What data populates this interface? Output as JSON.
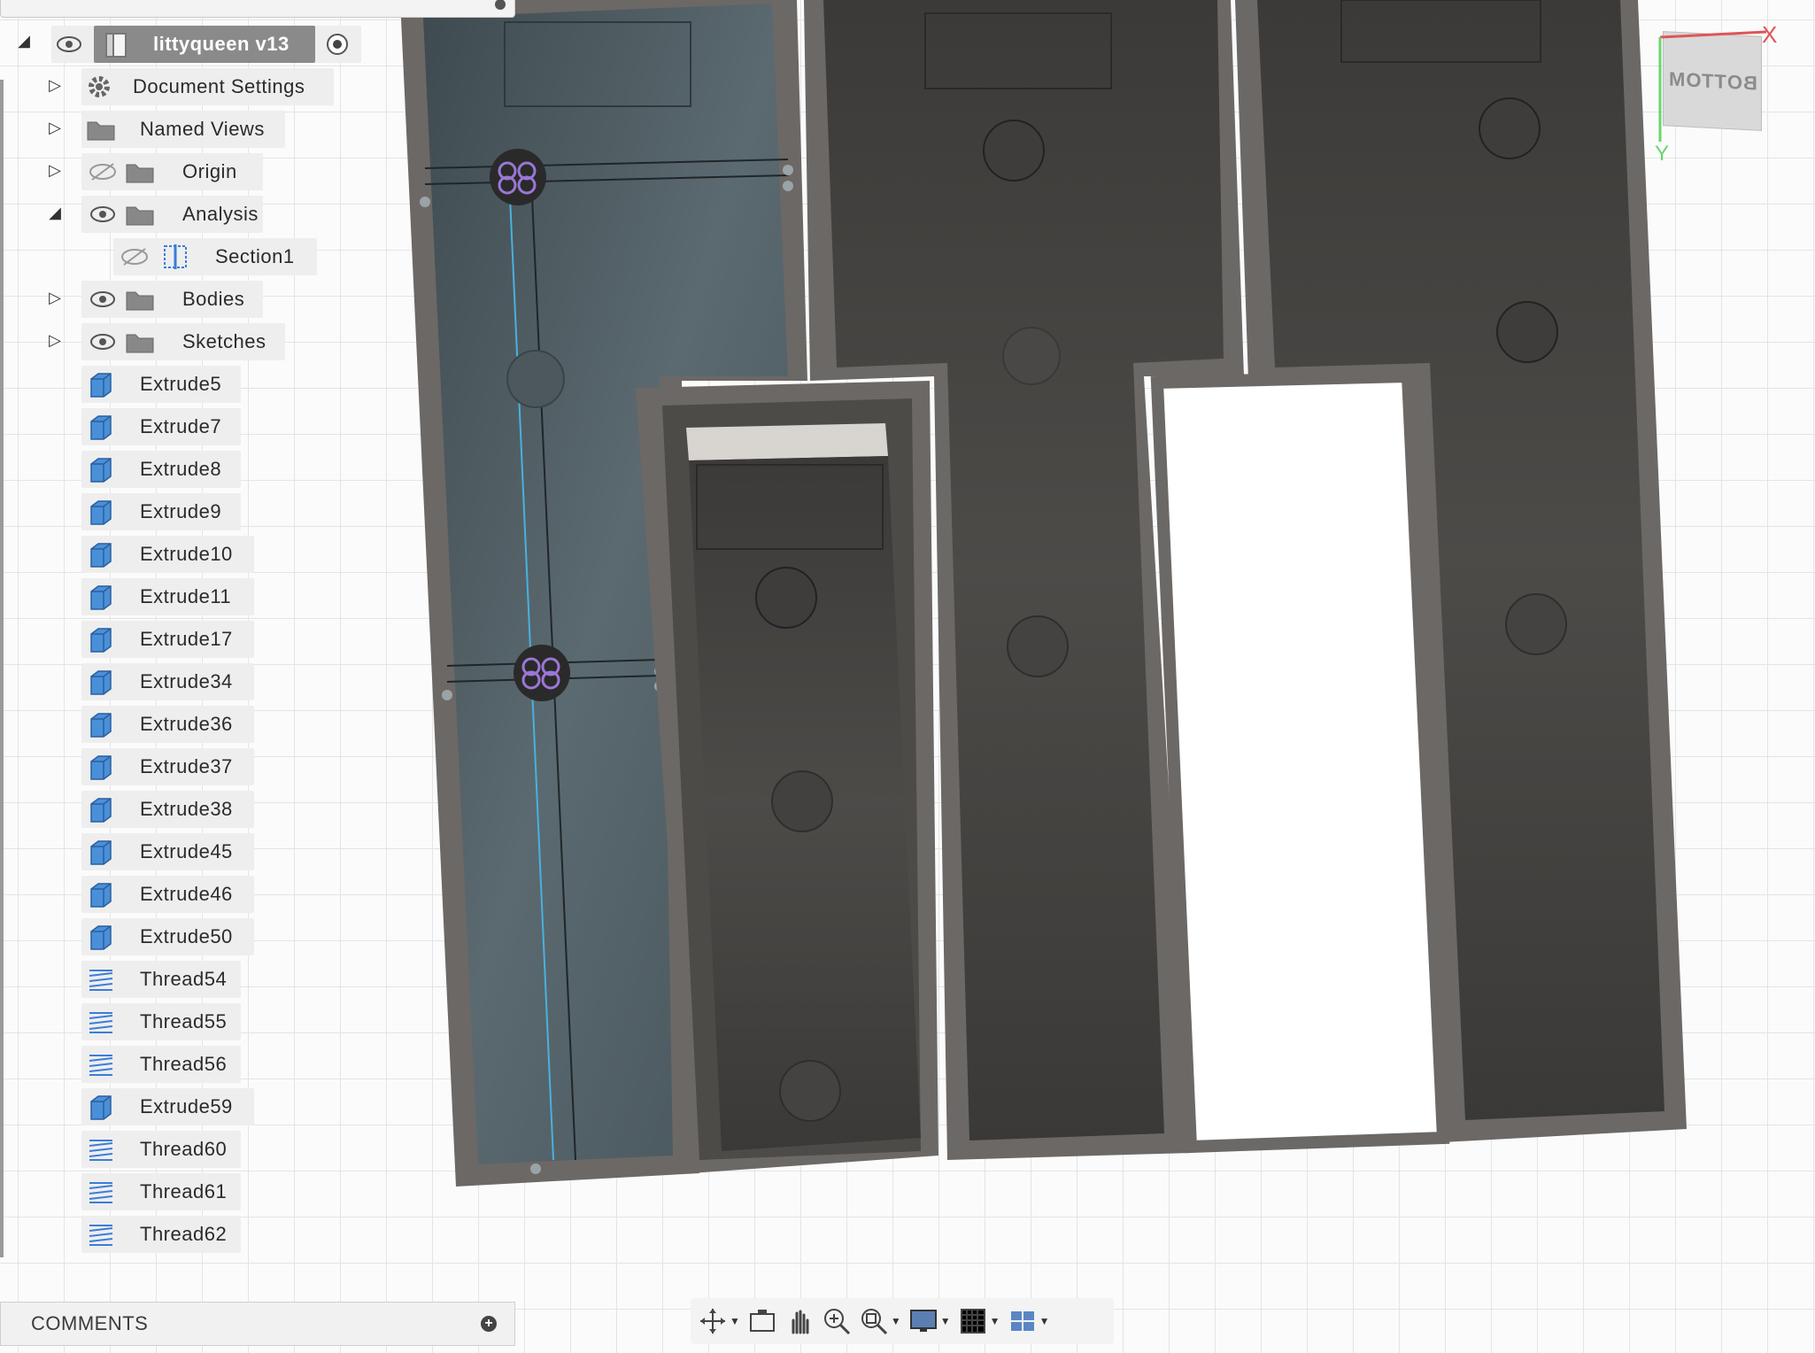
{
  "browser": {
    "root": {
      "label": "littyqueen v13"
    },
    "items": [
      {
        "label": "Document Settings",
        "icon": "gear-icon"
      },
      {
        "label": "Named Views",
        "icon": "folder-icon"
      },
      {
        "label": "Origin",
        "icon": "folder-icon"
      },
      {
        "label": "Analysis",
        "icon": "folder-icon"
      },
      {
        "label": "Section1",
        "icon": "section-analysis-icon"
      },
      {
        "label": "Bodies",
        "icon": "folder-icon"
      },
      {
        "label": "Sketches",
        "icon": "folder-icon"
      }
    ],
    "features": [
      {
        "label": "Extrude5",
        "type": "extrude"
      },
      {
        "label": "Extrude7",
        "type": "extrude"
      },
      {
        "label": "Extrude8",
        "type": "extrude"
      },
      {
        "label": "Extrude9",
        "type": "extrude"
      },
      {
        "label": "Extrude10",
        "type": "extrude"
      },
      {
        "label": "Extrude11",
        "type": "extrude"
      },
      {
        "label": "Extrude17",
        "type": "extrude"
      },
      {
        "label": "Extrude34",
        "type": "extrude"
      },
      {
        "label": "Extrude36",
        "type": "extrude"
      },
      {
        "label": "Extrude37",
        "type": "extrude"
      },
      {
        "label": "Extrude38",
        "type": "extrude"
      },
      {
        "label": "Extrude45",
        "type": "extrude"
      },
      {
        "label": "Extrude46",
        "type": "extrude"
      },
      {
        "label": "Extrude50",
        "type": "extrude"
      },
      {
        "label": "Thread54",
        "type": "thread"
      },
      {
        "label": "Thread55",
        "type": "thread"
      },
      {
        "label": "Thread56",
        "type": "thread"
      },
      {
        "label": "Extrude59",
        "type": "extrude"
      },
      {
        "label": "Thread60",
        "type": "thread"
      },
      {
        "label": "Thread61",
        "type": "thread"
      },
      {
        "label": "Thread62",
        "type": "thread"
      }
    ]
  },
  "comments": {
    "label": "COMMENTS"
  },
  "viewcube": {
    "face_label": "BOTTOM",
    "axis_x": "X",
    "axis_y": "Y"
  },
  "navbar": {
    "tools": [
      "orbit-icon",
      "look-at-icon",
      "pan-icon",
      "zoom-icon",
      "fit-icon",
      "display-settings-icon",
      "grid-icon",
      "viewports-icon"
    ]
  },
  "colors": {
    "extrude_icon": "#4a90d9",
    "thread_icon": "#3b7dd8",
    "body_dark": "#4a4845",
    "section_tint": "#4f5a5f",
    "frame": "#6f6a66"
  }
}
